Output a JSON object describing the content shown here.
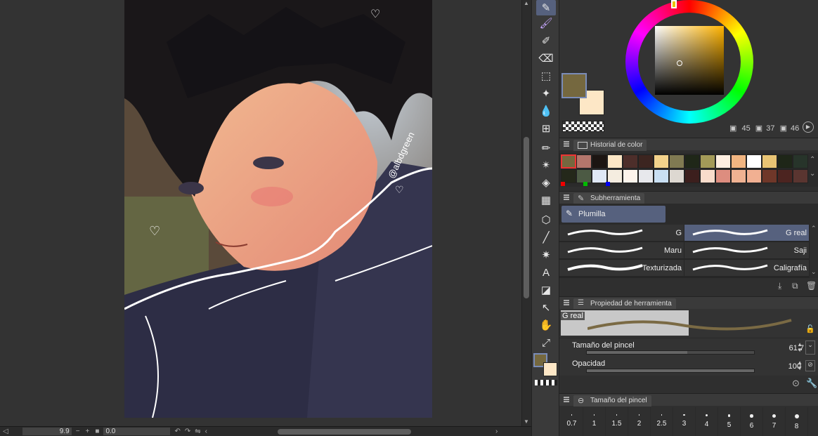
{
  "statusbar": {
    "zoom": "9.9",
    "angle": "0.0"
  },
  "color_wheel": {
    "foreground": "#75683f",
    "background": "#fde7c6",
    "h": "45",
    "s": "37",
    "v": "46"
  },
  "color_history": {
    "tab_label": "Historial de color",
    "row1": [
      "#75683f",
      "#b4766c",
      "#1c1512",
      "#fde7c6",
      "#4d2e2a",
      "#3c2520",
      "#f3d28b",
      "#807a52",
      "#1f2718",
      "#a39a58",
      "#fdeee0",
      "#f1b581",
      "#ffffff",
      "#e8c474",
      "#1e2618",
      "#27342a"
    ],
    "row2": [
      "#24281a",
      "#4c5a44",
      "#dfe8f6",
      "#f5ede0",
      "#fdf4ec",
      "#e7e8ec",
      "#c9dff3",
      "#ddd8d1",
      "#3c1f1d",
      "#f9dccb",
      "#dd8d7f",
      "#f0b292",
      "#f1b092",
      "#6f3729",
      "#4c2420",
      "#5a3530"
    ]
  },
  "subtool": {
    "tab_label": "Subherramienta",
    "group": "Plumilla",
    "brushes": [
      {
        "name": "G",
        "col": 0,
        "row": 0
      },
      {
        "name": "G real",
        "col": 1,
        "row": 0,
        "selected": true
      },
      {
        "name": "Maru",
        "col": 0,
        "row": 1
      },
      {
        "name": "Saji",
        "col": 1,
        "row": 1
      },
      {
        "name": "Texturizada",
        "col": 0,
        "row": 2
      },
      {
        "name": "Caligrafía",
        "col": 1,
        "row": 2
      }
    ]
  },
  "tool_property": {
    "tab_label": "Propiedad de herramienta",
    "preview_name": "G real",
    "brush_size_label": "Tamaño del pincel",
    "brush_size_value": "61.7",
    "brush_size_fraction": 0.6,
    "opacity_label": "Opacidad",
    "opacity_value": "100",
    "opacity_fraction": 1.0
  },
  "brush_size_panel": {
    "tab_label": "Tamaño del pincel",
    "sizes": [
      "0.7",
      "1",
      "1.5",
      "2",
      "2.5",
      "3",
      "4",
      "5",
      "6",
      "7",
      "8"
    ]
  },
  "artwork": {
    "signature": "@albdgreen"
  }
}
